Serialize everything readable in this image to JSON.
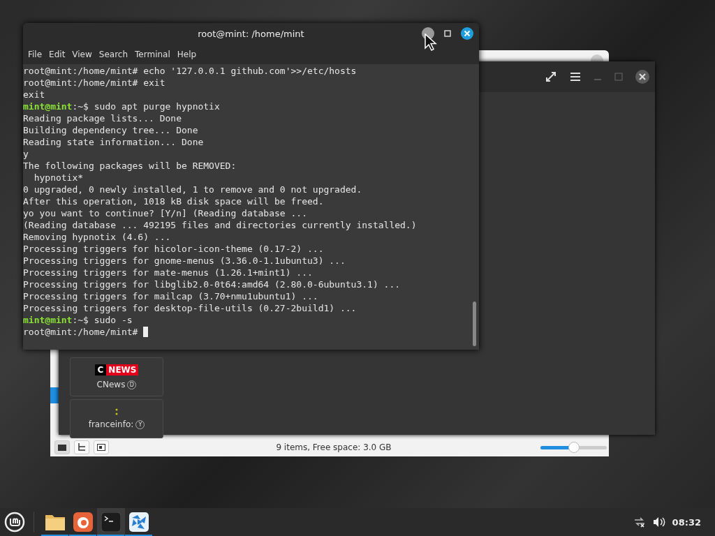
{
  "terminal": {
    "title": "root@mint: /home/mint",
    "menu": [
      "File",
      "Edit",
      "View",
      "Search",
      "Terminal",
      "Help"
    ],
    "lines": [
      {
        "text": "root@mint:/home/mint# echo '127.0.0.1 github.com'>>/etc/hosts"
      },
      {
        "text": "root@mint:/home/mint# exit"
      },
      {
        "text": "exit"
      },
      {
        "user": "mint@mint",
        "text": ":~$ sudo apt purge hypnotix"
      },
      {
        "text": "Reading package lists... Done"
      },
      {
        "text": "Building dependency tree... Done"
      },
      {
        "text": "Reading state information... Done"
      },
      {
        "text": "y"
      },
      {
        "text": "The following packages will be REMOVED:"
      },
      {
        "text": "  hypnotix*"
      },
      {
        "text": "0 upgraded, 0 newly installed, 1 to remove and 0 not upgraded."
      },
      {
        "text": "After this operation, 1018 kB disk space will be freed."
      },
      {
        "text": "yo you want to continue? [Y/n] (Reading database ..."
      },
      {
        "text": "(Reading database ... 492195 files and directories currently installed.)"
      },
      {
        "text": "Removing hypnotix (4.6) ..."
      },
      {
        "text": "Processing triggers for hicolor-icon-theme (0.17-2) ..."
      },
      {
        "text": "Processing triggers for gnome-menus (3.36.0-1.1ubuntu3) ..."
      },
      {
        "text": "Processing triggers for mate-menus (1.26.1+mint1) ..."
      },
      {
        "text": "Processing triggers for libglib2.0-0t64:amd64 (2.80.0-6ubuntu3.1) ..."
      },
      {
        "text": "Processing triggers for mailcap (3.70+nmu1ubuntu1) ..."
      },
      {
        "text": "Processing triggers for desktop-file-utils (0.27-2build1) ..."
      },
      {
        "user": "mint@mint",
        "text": ":~$ sudo -s"
      },
      {
        "text": "root@mint:/home/mint# "
      }
    ],
    "cursor": true
  },
  "player": {
    "channels": [
      {
        "logo": {
          "kind": "wordmark",
          "mark": "C",
          "word": "NEWS"
        },
        "name": "CNews",
        "badge": "D"
      },
      {
        "logo": {
          "kind": "dots"
        },
        "name": "franceinfo:",
        "badge": "Y"
      }
    ]
  },
  "files": {
    "status": "9 items, Free space: 3.0 GB",
    "zoom": {
      "level": 0.5
    }
  },
  "taskbar": {
    "apps": [
      {
        "kind": "folder",
        "selected": false
      },
      {
        "kind": "browser",
        "selected": false
      },
      {
        "kind": "terminal",
        "selected": true
      },
      {
        "kind": "player",
        "selected": false
      }
    ],
    "clock": "08:32"
  }
}
